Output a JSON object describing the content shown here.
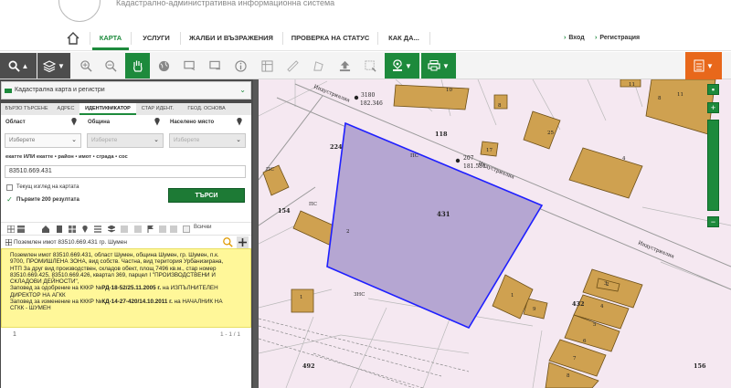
{
  "header": {
    "subtitle": "Кадастрално-административна информационна система"
  },
  "nav": {
    "items": [
      {
        "label": "КАРТА",
        "active": true
      },
      {
        "label": "УСЛУГИ",
        "active": false
      },
      {
        "label": "ЖАЛБИ И ВЪЗРАЖЕНИЯ",
        "active": false
      },
      {
        "label": "ПРОВЕРКА НА СТАТУС",
        "active": false
      },
      {
        "label": "КАК ДА...",
        "active": false
      }
    ],
    "login": "Вход",
    "register": "Регистрация"
  },
  "panel": {
    "layer_select": "Кадастрална карта и регистри",
    "tabs": [
      "БЪРЗО ТЪРСЕНЕ",
      "АДРЕС",
      "ИДЕНТИФИКАТОР",
      "СТАР ИДЕНТ.",
      "ГЕОД. ОСНОВА"
    ],
    "form": {
      "region_label": "Област",
      "municipality_label": "Община",
      "settlement_label": "Населено място",
      "region_value": "Изберете",
      "municipality_value": "Изберете",
      "settlement_value": "Изберете",
      "ekatte_label": "екатте ИЛИ екатте • район • имот • сграда • сос",
      "ekatte_value": "83510.669.431",
      "current_extent_label": "Текущ изглед на картата",
      "first_200_label": "Първите 200 резултата",
      "search_button": "ТЪРСИ"
    },
    "watermark": "0898814640",
    "all_label": "Всички",
    "result": {
      "title": "Поземлен имот 83510.669.431 гр. Шумен",
      "lines": [
        "Поземлен имот 83510.669.431, област Шумен, община Шумен, гр. Шумен, п.к.",
        "9700, ПРОМИШЛЕНА ЗОНА, вид собств. Частна, вид територия Урбанизирана,",
        "НТП За друг вид производствен, складов обект, площ 7496 кв.м., стар номер",
        "83510.669.425, 83510.669.426, квартал 369, парцел I \"ПРОИЗВОДСТВЕНИ И",
        "СКЛАДОВИ ДЕЙНОСТИ\","
      ],
      "order1_prefix": "Заповед за одобрение на КККР №",
      "order1_number": "РД-18-52/25.11.2005 г.",
      "order1_suffix": " на ИЗПЪЛНИТЕЛЕН",
      "order1_line2": "ДИРЕКТОР НА АГКК",
      "order2_prefix": "Заповед за изменение на КККР №",
      "order2_number": "КД-14-27-420/14.10.2011 г.",
      "order2_suffix": " на НАЧАЛНИК НА",
      "order2_line2": "СГКК - ШУМЕН"
    },
    "pager": {
      "page": "1",
      "range": "1 - 1 / 1"
    }
  },
  "map": {
    "streets": [
      "Индустриална",
      "Индустриална",
      "Индустриална"
    ],
    "labels": {
      "point1_id": "3180",
      "point1_elev": "182.346",
      "point2_id": "207",
      "point2_elev": "181.581",
      "selected_parcel": "431",
      "parcels": [
        "224",
        "118",
        "154",
        "432",
        "492",
        "156"
      ],
      "buildings": [
        "10",
        "8",
        "11",
        "8",
        "11",
        "25",
        "17",
        "4",
        "2",
        "3",
        "4",
        "5",
        "6",
        "7",
        "8",
        "9",
        "1",
        "2",
        "1"
      ],
      "kinds": [
        "ПС",
        "ПС",
        "ПС",
        "ЗНС"
      ]
    }
  }
}
